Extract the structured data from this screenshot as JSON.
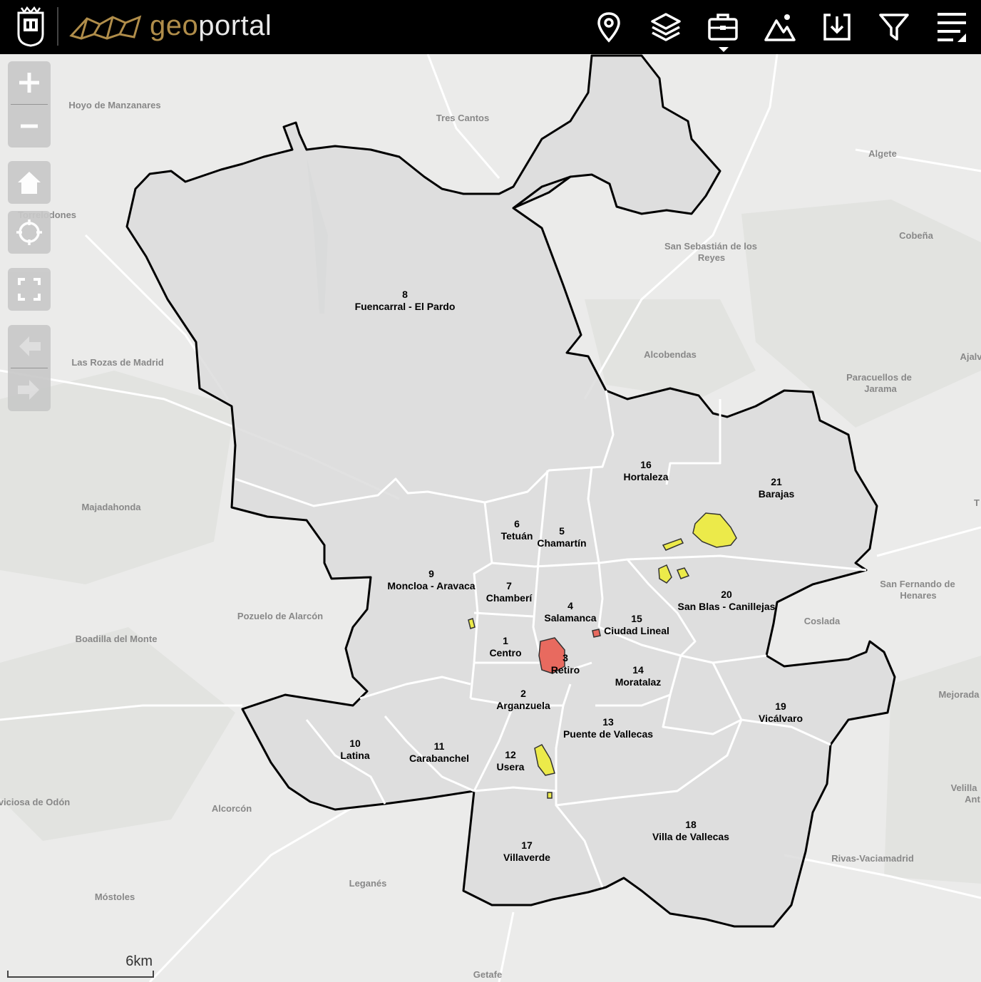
{
  "header": {
    "brand_geo": "geo",
    "brand_portal": "portal",
    "tools": [
      {
        "name": "location-tool",
        "icon": "map-pin-icon"
      },
      {
        "name": "layers-tool",
        "icon": "layers-icon"
      },
      {
        "name": "toolbox-tool",
        "icon": "briefcase-icon",
        "active": true
      },
      {
        "name": "terrain-tool",
        "icon": "mountain-icon"
      },
      {
        "name": "download-tool",
        "icon": "download-icon"
      },
      {
        "name": "filter-tool",
        "icon": "filter-icon"
      },
      {
        "name": "menu-tool",
        "icon": "menu-icon"
      }
    ]
  },
  "controls": {
    "zoom_in": "zoom-in-icon",
    "zoom_out": "zoom-out-icon",
    "home": "home-icon",
    "locate": "locate-icon",
    "fullscreen": "fullscreen-icon",
    "back": "arrow-left-icon",
    "forward": "arrow-right-icon"
  },
  "scale": {
    "label": "6km"
  },
  "colors": {
    "district_fill": "#dcdcdc",
    "boundary": "#000000",
    "internal_boundary": "#ffffff",
    "highlight_red": "#e86a5f",
    "highlight_yellow": "#ecea4a",
    "brand_gold": "#b08d4a"
  },
  "districts": [
    {
      "number": "1",
      "name": "Centro"
    },
    {
      "number": "2",
      "name": "Arganzuela"
    },
    {
      "number": "3",
      "name": "Retiro"
    },
    {
      "number": "4",
      "name": "Salamanca"
    },
    {
      "number": "5",
      "name": "Chamartín"
    },
    {
      "number": "6",
      "name": "Tetuán"
    },
    {
      "number": "7",
      "name": "Chamberí"
    },
    {
      "number": "8",
      "name": "Fuencarral - El Pardo"
    },
    {
      "number": "9",
      "name": "Moncloa - Aravaca"
    },
    {
      "number": "10",
      "name": "Latina"
    },
    {
      "number": "11",
      "name": "Carabanchel"
    },
    {
      "number": "12",
      "name": "Usera"
    },
    {
      "number": "13",
      "name": "Puente de Vallecas"
    },
    {
      "number": "14",
      "name": "Moratalaz"
    },
    {
      "number": "15",
      "name": "Ciudad Lineal"
    },
    {
      "number": "16",
      "name": "Hortaleza"
    },
    {
      "number": "17",
      "name": "Villaverde"
    },
    {
      "number": "18",
      "name": "Villa de Vallecas"
    },
    {
      "number": "19",
      "name": "Vicálvaro"
    },
    {
      "number": "20",
      "name": "San Blas - Canillejas"
    },
    {
      "number": "21",
      "name": "Barajas"
    }
  ],
  "places": [
    "Hoyo de Manzanares",
    "Tres Cantos",
    "Algete",
    "Torrelodones",
    "Cobeña",
    "San Sebastián de los",
    "Reyes",
    "Alcobendas",
    "Ajalv",
    "Paracuellos de",
    "Jarama",
    "Las Rozas de Madrid",
    "Majadahonda",
    "T",
    "San Fernando de",
    "Henares",
    "Pozuelo de Alarcón",
    "Boadilla del Monte",
    "Coslada",
    "Mejorada",
    "viciosa de Odón",
    "Alcorcón",
    "Velilla",
    "Ant",
    "Rivas-Vaciamadrid",
    "Leganés",
    "Móstoles",
    "Getafe"
  ]
}
